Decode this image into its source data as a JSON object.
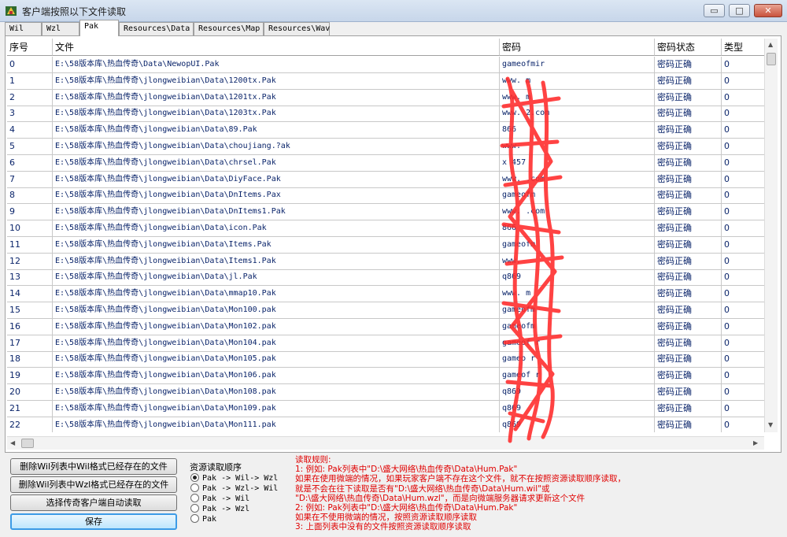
{
  "window": {
    "title": "客户端按照以下文件读取",
    "min": "▭",
    "max": "□",
    "close": "✕"
  },
  "tabs": [
    {
      "label": "Wil"
    },
    {
      "label": "Wzl"
    },
    {
      "label": "Pak"
    },
    {
      "label": "Resources\\Data"
    },
    {
      "label": "Resources\\Map"
    },
    {
      "label": "Resources\\Wav"
    }
  ],
  "table": {
    "columns": [
      "序号",
      "文件",
      "密码",
      "密码状态",
      "类型"
    ],
    "rows": [
      {
        "no": "0",
        "file": "E:\\58版本库\\热血传奇\\Data\\NewopUI.Pak",
        "pw": "gameofmir",
        "status": "密码正确",
        "type": "0"
      },
      {
        "no": "1",
        "file": "E:\\58版本库\\热血传奇\\jlongweibian\\Data\\1200tx.Pak",
        "pw": "www.           m",
        "status": "密码正确",
        "type": "0"
      },
      {
        "no": "2",
        "file": "E:\\58版本库\\热血传奇\\jlongweibian\\Data\\1201tx.Pak",
        "pw": "www.           m",
        "status": "密码正确",
        "type": "0"
      },
      {
        "no": "3",
        "file": "E:\\58版本库\\热血传奇\\jlongweibian\\Data\\1203tx.Pak",
        "pw": "www.          2.com",
        "status": "密码正确",
        "type": "0"
      },
      {
        "no": "4",
        "file": "E:\\58版本库\\热血传奇\\jlongweibian\\Data\\89.Pak",
        "pw": "866",
        "status": "密码正确",
        "type": "0"
      },
      {
        "no": "5",
        "file": "E:\\58版本库\\热血传奇\\jlongweibian\\Data\\choujiang.?ak",
        "pw": "www.",
        "status": "密码正确",
        "type": "0"
      },
      {
        "no": "6",
        "file": "E:\\58版本库\\热血传奇\\jlongweibian\\Data\\chrsel.Pak",
        "pw": "x          457",
        "status": "密码正确",
        "type": "0"
      },
      {
        "no": "7",
        "file": "E:\\58版本库\\热血传奇\\jlongweibian\\Data\\DiyFace.Pak",
        "pw": "www.           .com",
        "status": "密码正确",
        "type": "0"
      },
      {
        "no": "8",
        "file": "E:\\58版本库\\热血传奇\\jlongweibian\\Data\\DnItems.Pax",
        "pw": "gameofm",
        "status": "密码正确",
        "type": "0"
      },
      {
        "no": "9",
        "file": "E:\\58版本库\\热血传奇\\jlongweibian\\Data\\DnItems1.Pak",
        "pw": "www.           .com",
        "status": "密码正确",
        "type": "0"
      },
      {
        "no": "10",
        "file": "E:\\58版本库\\热血传奇\\jlongweibian\\Data\\icon.Pak",
        "pw": "866",
        "status": "密码正确",
        "type": "0"
      },
      {
        "no": "11",
        "file": "E:\\58版本库\\热血传奇\\jlongweibian\\Data\\Items.Pak",
        "pw": "gameofm",
        "status": "密码正确",
        "type": "0"
      },
      {
        "no": "12",
        "file": "E:\\58版本库\\热血传奇\\jlongweibian\\Data\\Items1.Pak",
        "pw": "www.",
        "status": "密码正确",
        "type": "0"
      },
      {
        "no": "13",
        "file": "E:\\58版本库\\热血传奇\\jlongweibian\\Data\\jl.Pak",
        "pw": "q869",
        "status": "密码正确",
        "type": "0"
      },
      {
        "no": "14",
        "file": "E:\\58版本库\\热血传奇\\jlongweibian\\Data\\mmap10.Pak",
        "pw": "www.           m",
        "status": "密码正确",
        "type": "0"
      },
      {
        "no": "15",
        "file": "E:\\58版本库\\热血传奇\\jlongweibian\\Data\\Mon100.pak",
        "pw": "gameofm",
        "status": "密码正确",
        "type": "0"
      },
      {
        "no": "16",
        "file": "E:\\58版本库\\热血传奇\\jlongweibian\\Data\\Mon102.pak",
        "pw": "gameofm",
        "status": "密码正确",
        "type": "0"
      },
      {
        "no": "17",
        "file": "E:\\58版本库\\热血传奇\\jlongweibian\\Data\\Mon104.pak",
        "pw": "gameof     r",
        "status": "密码正确",
        "type": "0"
      },
      {
        "no": "18",
        "file": "E:\\58版本库\\热血传奇\\jlongweibian\\Data\\Mon105.pak",
        "pw": "gameo     r",
        "status": "密码正确",
        "type": "0"
      },
      {
        "no": "19",
        "file": "E:\\58版本库\\热血传奇\\jlongweibian\\Data\\Mon106.pak",
        "pw": "gameof    r",
        "status": "密码正确",
        "type": "0"
      },
      {
        "no": "20",
        "file": "E:\\58版本库\\热血传奇\\jlongweibian\\Data\\Mon108.pak",
        "pw": "q869",
        "status": "密码正确",
        "type": "0"
      },
      {
        "no": "21",
        "file": "E:\\58版本库\\热血传奇\\jlongweibian\\Data\\Mon109.pak",
        "pw": "q869",
        "status": "密码正确",
        "type": "0"
      },
      {
        "no": "22",
        "file": "E:\\58版本库\\热血传奇\\jlongweibian\\Data\\Mon111.pak",
        "pw": "q869",
        "status": "密码正确",
        "type": "0"
      }
    ]
  },
  "buttons": {
    "delete_wil": "删除Wil列表中Wil格式已经存在的文件",
    "delete_wzl": "删除Wil列表中Wzl格式已经存在的文件",
    "auto_read": "选择传奇客户端自动读取",
    "save": "保存"
  },
  "resource_order": {
    "title": "资源读取顺序",
    "options": [
      {
        "label": "Pak -> Wil-> Wzl",
        "checked": true
      },
      {
        "label": "Pak -> Wzl-> Wil",
        "checked": false
      },
      {
        "label": "Pak -> Wil",
        "checked": false
      },
      {
        "label": "Pak -> Wzl",
        "checked": false
      },
      {
        "label": "Pak",
        "checked": false
      }
    ]
  },
  "rules": {
    "lines": [
      "读取规则:",
      "1: 例如: Pak列表中\"D:\\盛大网络\\热血传奇\\Data\\Hum.Pak\"",
      "    如果在使用微端的情况，如果玩家客户端不存在这个文件，就不在按照资源读取顺序读取，",
      "    就是不会在往下读取是否有\"D:\\盛大网络\\热血传奇\\Data\\Hum.wil\"或",
      "    \"D:\\盛大网络\\热血传奇\\Data\\Hum.wzl\"，而是向微端服务器请求更新这个文件",
      "2: 例如: Pak列表中\"D:\\盛大网络\\热血传奇\\Data\\Hum.Pak\"",
      "    如果在不使用微端的情况，按照资源读取顺序读取",
      "3: 上面列表中没有的文件按照资源读取顺序读取"
    ]
  },
  "colors": {
    "text_blue": "#0a246a",
    "rules_red": "#e00000",
    "redaction": "#ff2a2a"
  }
}
